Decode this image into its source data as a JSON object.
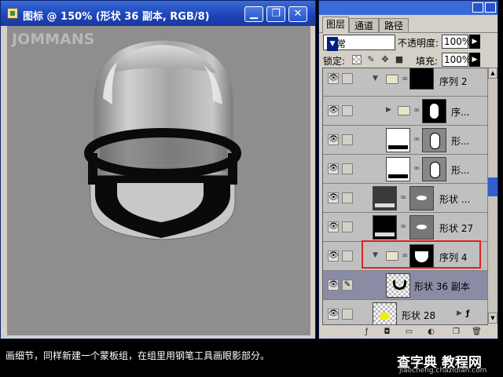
{
  "document": {
    "title": "图标 @ 150% (形状 36 副本, RGB/8)",
    "watermark": "JOMMANS",
    "buttons": {
      "minimize": "▁",
      "restore": "❐",
      "close": "✕"
    }
  },
  "layers_panel": {
    "tabs": [
      {
        "label": "图层",
        "active": true
      },
      {
        "label": "通道",
        "active": false
      },
      {
        "label": "路径",
        "active": false
      }
    ],
    "blend_mode": "正常",
    "opacity_label": "不透明度:",
    "opacity_value": "100%",
    "lock_label": "锁定:",
    "fill_label": "填充:",
    "fill_value": "100%",
    "layers": [
      {
        "name": "序列 2",
        "type": "group",
        "expanded": true,
        "visible": true
      },
      {
        "name": "序...",
        "type": "group",
        "expanded": false,
        "visible": true
      },
      {
        "name": "形...",
        "type": "shape",
        "visible": true
      },
      {
        "name": "形...",
        "type": "shape",
        "visible": true
      },
      {
        "name": "形状 ...",
        "type": "shape",
        "visible": true
      },
      {
        "name": "形状 27",
        "type": "shape",
        "visible": true
      },
      {
        "name": "序列 4",
        "type": "group",
        "expanded": true,
        "visible": true,
        "highlighted": true
      },
      {
        "name": "形状 36 副本",
        "type": "layer",
        "visible": true,
        "selected": true
      },
      {
        "name": "形状 28",
        "type": "layer",
        "visible": true
      }
    ]
  },
  "caption": "画细节，同样新建一个蒙板组，在组里用钢笔工具画眼影部分。",
  "site": {
    "name": "查字典 教程网",
    "url": "jiaocheng.chazidian.com"
  },
  "colors": {
    "highlight_border": "#e02020",
    "canvas_bg": "#8e8e8e",
    "titlebar": "#1c43b8"
  }
}
